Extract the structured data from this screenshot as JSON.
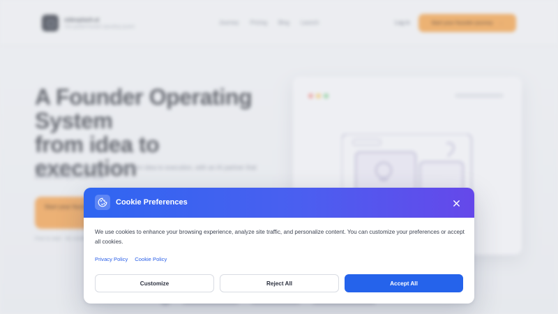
{
  "background": {
    "brand_name": "sidesplash.ai",
    "brand_tagline": "Your guided founder operating system",
    "nav_links": [
      "Journey",
      "Pricing",
      "Blog",
      "Launch"
    ],
    "login_label": "Log in",
    "nav_cta_label": "Start your founder journey",
    "hero_title_line1": "A Founder Operating",
    "hero_title_line2": "System",
    "hero_title_line3": "from idea to execution",
    "hero_subtitle": "Guide your entire founder journey from idea to execution, with an AI partner that thinks with you over time.",
    "hero_cta_label": "Start your founder journey",
    "hero_note": "Free to start · No credit card needed",
    "colors": {
      "accent_orange": "#f59a37",
      "dark": "#1f2430"
    }
  },
  "cookie_dialog": {
    "title": "Cookie Preferences",
    "header_icon": "cookie-icon",
    "close_icon": "close-icon",
    "message": "We use cookies to enhance your browsing experience, analyze site traffic, and personalize content. You can customize your preferences or accept all cookies.",
    "links": {
      "privacy": "Privacy Policy",
      "cookie": "Cookie Policy"
    },
    "buttons": {
      "customize": "Customize",
      "reject": "Reject All",
      "accept": "Accept All"
    },
    "colors": {
      "header_start": "#2f66f1",
      "header_end": "#6548ea",
      "primary": "#2563eb",
      "link": "#2c61e8"
    }
  }
}
